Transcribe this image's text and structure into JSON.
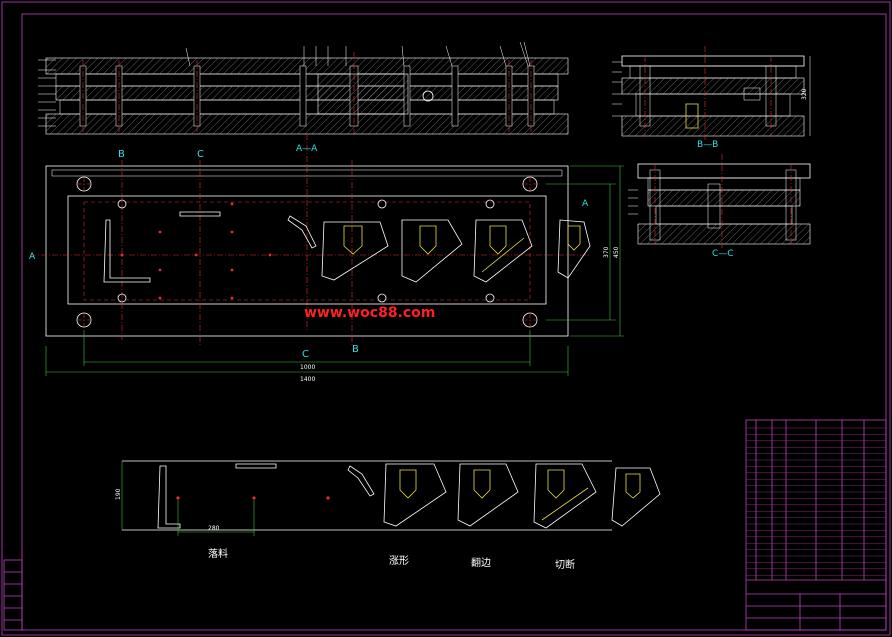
{
  "watermark": "www.woc88.com",
  "section_labels": {
    "a": "A",
    "b": "B",
    "c": "C",
    "aa": "A—A",
    "bb": "B—B",
    "cc": "C—C"
  },
  "dimensions": {
    "total_length": "1400",
    "inner_length": "1000",
    "right_height_1": "370",
    "right_height_2": "450",
    "strip_pitch": "280",
    "strip_width": "190",
    "bb_height": "320"
  },
  "process_steps": {
    "step1": "落料",
    "step2": "涨形",
    "step3": "翻边",
    "step4": "切断"
  },
  "colors": {
    "background": "#000000",
    "frame": "#c040c0",
    "centerline": "#e03030",
    "outline": "#ffffff",
    "accent": "#30e0e0",
    "highlight": "#e8e040",
    "watermark": "#ff2020"
  }
}
